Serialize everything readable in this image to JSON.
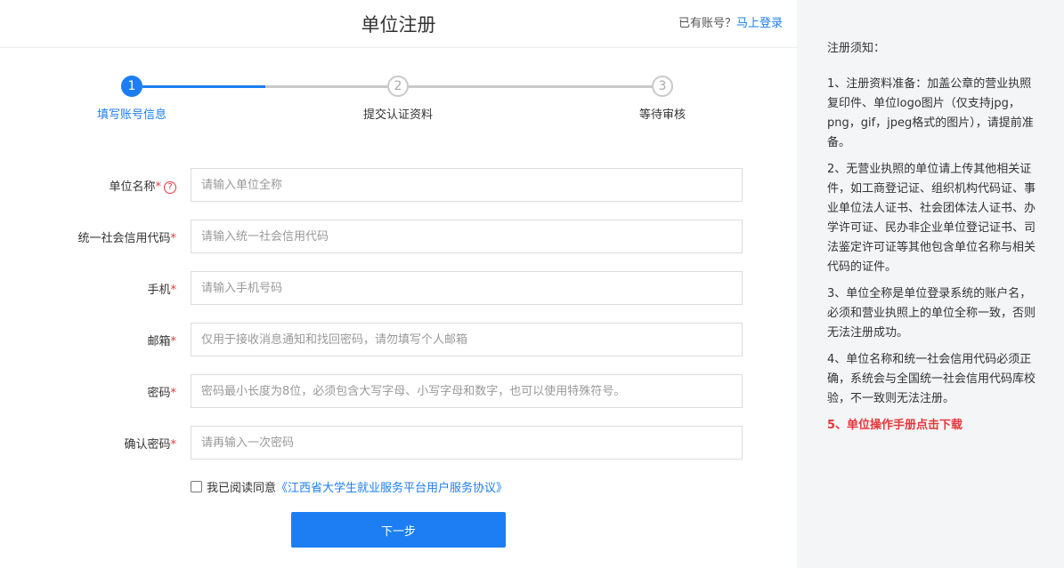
{
  "header": {
    "title": "单位注册",
    "login_prompt": "已有账号？",
    "login_link": "马上登录"
  },
  "steps": [
    {
      "number": "1",
      "label": "填写账号信息",
      "active": true
    },
    {
      "number": "2",
      "label": "提交认证资料",
      "active": false
    },
    {
      "number": "3",
      "label": "等待审核",
      "active": false
    }
  ],
  "form": {
    "fields": [
      {
        "label": "单位名称",
        "required": "*",
        "help": "?",
        "placeholder": "请输入单位全称"
      },
      {
        "label": "统一社会信用代码",
        "required": "*",
        "placeholder": "请输入统一社会信用代码"
      },
      {
        "label": "手机",
        "required": "*",
        "placeholder": "请输入手机号码"
      },
      {
        "label": "邮箱",
        "required": "*",
        "placeholder": "仅用于接收消息通知和找回密码，请勿填写个人邮箱"
      },
      {
        "label": "密码",
        "required": "*",
        "placeholder": "密码最小长度为8位，必须包含大写字母、小写字母和数字，也可以使用特殊符号。"
      },
      {
        "label": "确认密码",
        "required": "*",
        "placeholder": "请再输入一次密码"
      }
    ],
    "agree_text": "我已阅读同意",
    "agree_link": "《江西省大学生就业服务平台用户服务协议》",
    "agree_checked": false,
    "next_label": "下一步"
  },
  "notice": {
    "title": "注册须知：",
    "items": [
      "1、注册资料准备：加盖公章的营业执照复印件、单位logo图片（仅支持jpg，png，gif，jpeg格式的图片），请提前准备。",
      "2、无营业执照的单位请上传其他相关证件，如工商登记证、组织机构代码证、事业单位法人证书、社会团体法人证书、办学许可证、民办非企业单位登记证书、司法鉴定许可证等其他包含单位名称与相关代码的证件。",
      "3、单位全称是单位登录系统的账户名，必须和营业执照上的单位全称一致，否则无法注册成功。",
      "4、单位名称和统一社会信用代码必须正确，系统会与全国统一社会信用代码库校验，不一致则无法注册。",
      "5、单位操作手册点击下载"
    ]
  },
  "colors": {
    "accent": "#1c7ef2",
    "required": "#e4393c",
    "track_inactive": "#c9c9c9"
  }
}
